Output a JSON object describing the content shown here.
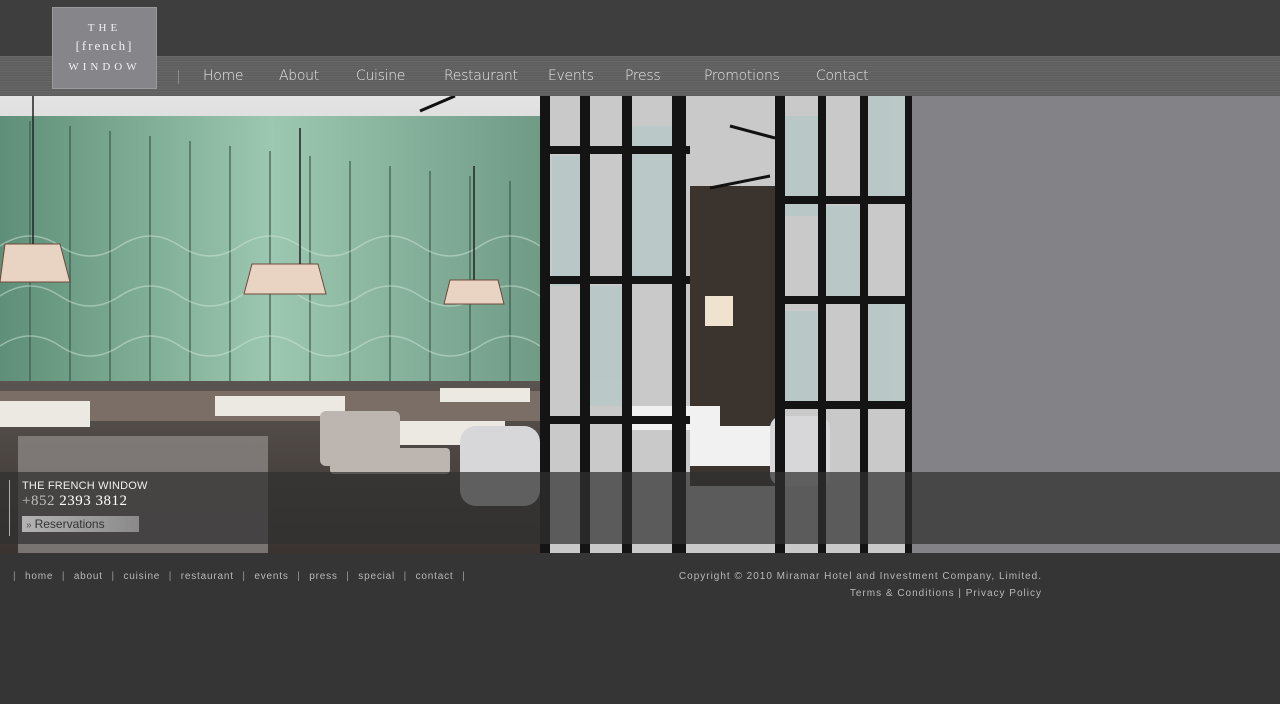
{
  "logo": {
    "line1": "THE",
    "line2": "[french]",
    "line3": "WINDOW"
  },
  "nav": {
    "items": [
      {
        "label": "Home"
      },
      {
        "label": "About"
      },
      {
        "label": "Cuisine"
      },
      {
        "label": "Restaurant"
      },
      {
        "label": "Events"
      },
      {
        "label": "Press"
      },
      {
        "label": "Promotions"
      },
      {
        "label": "Contact"
      }
    ]
  },
  "info": {
    "name": "THE FRENCH WINDOW",
    "phone_prefix": "+852",
    "phone_number": "2393 3812",
    "reservations_label": "Reservations"
  },
  "footer": {
    "links": [
      {
        "label": "home"
      },
      {
        "label": "about"
      },
      {
        "label": "cuisine"
      },
      {
        "label": "restaurant"
      },
      {
        "label": "events"
      },
      {
        "label": "press"
      },
      {
        "label": "special"
      },
      {
        "label": "contact"
      }
    ],
    "copyright": "Copyright © 2010 Miramar Hotel and Investment Company, Limited.",
    "terms": "Terms & Conditions",
    "privacy": "Privacy Policy"
  },
  "colors": {
    "page_bg": "#353535",
    "side_panel": "#838287",
    "nav_text": "#e6e6e6"
  }
}
